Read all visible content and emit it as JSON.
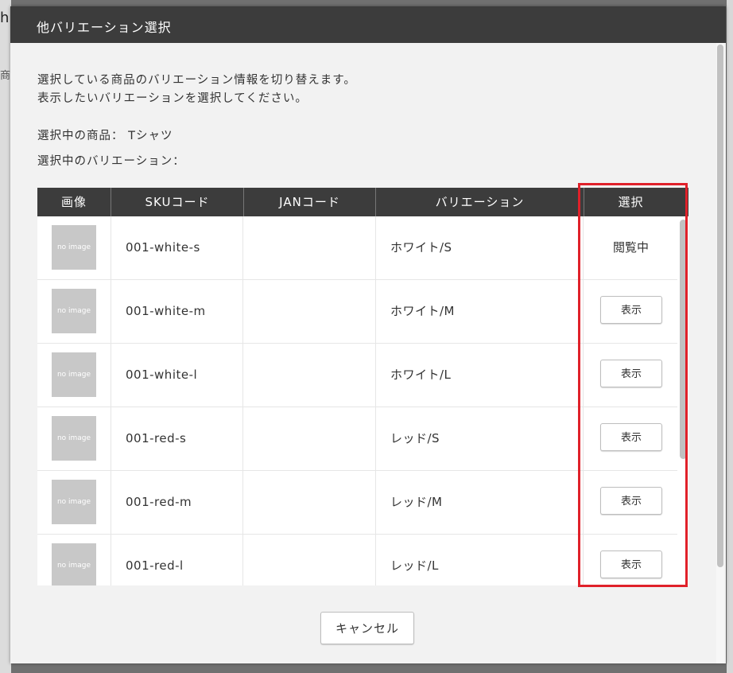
{
  "background": {
    "left_char1": "h",
    "left_char2": "商"
  },
  "modal": {
    "title": "他バリエーション選択",
    "description_line1": "選択している商品のバリエーション情報を切り替えます。",
    "description_line2": "表示したいバリエーションを選択してください。",
    "selected_product_label": "選択中の商品：",
    "selected_product_value": "Tシャツ",
    "selected_variation_label": "選択中のバリエーション：",
    "selected_variation_value": "",
    "cancel_label": "キャンセル"
  },
  "table": {
    "headers": [
      "画像",
      "SKUコード",
      "JANコード",
      "バリエーション",
      "選択"
    ],
    "rows": [
      {
        "thumb": "no image",
        "sku": "001-white-s",
        "jan": "",
        "variation": "ホワイト/S",
        "action": "閲覧中",
        "is_current": true
      },
      {
        "thumb": "no image",
        "sku": "001-white-m",
        "jan": "",
        "variation": "ホワイト/M",
        "action": "表示",
        "is_current": false
      },
      {
        "thumb": "no image",
        "sku": "001-white-l",
        "jan": "",
        "variation": "ホワイト/L",
        "action": "表示",
        "is_current": false
      },
      {
        "thumb": "no image",
        "sku": "001-red-s",
        "jan": "",
        "variation": "レッド/S",
        "action": "表示",
        "is_current": false
      },
      {
        "thumb": "no image",
        "sku": "001-red-m",
        "jan": "",
        "variation": "レッド/M",
        "action": "表示",
        "is_current": false
      },
      {
        "thumb": "no image",
        "sku": "001-red-l",
        "jan": "",
        "variation": "レッド/L",
        "action": "表示",
        "is_current": false
      }
    ]
  },
  "colors": {
    "header_bg": "#3c3c3c",
    "highlight": "#e0212a",
    "thumb_bg": "#c8c8c8"
  }
}
